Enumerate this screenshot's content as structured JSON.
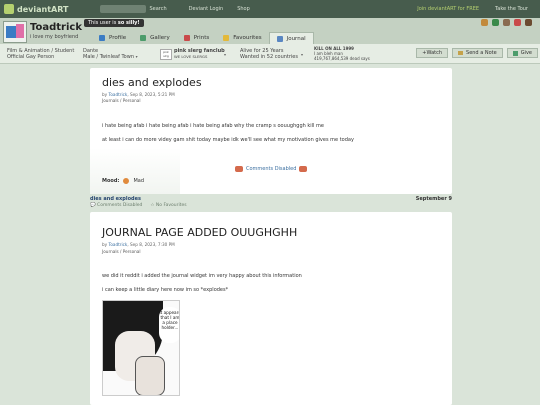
{
  "topbar": {
    "logo": "deviantART",
    "search_label": "Search",
    "nav": [
      "Deviant Login",
      "Shop"
    ],
    "join": "Join deviantART for FREE",
    "tour": "Take the Tour"
  },
  "header": {
    "username": "Toadtrick",
    "tagline": "i love my boyfriend",
    "tooltip_prefix": "This user is ",
    "tooltip_strong": "so silly!",
    "tabs": [
      {
        "label": "Profile",
        "active": false
      },
      {
        "label": "Gallery",
        "active": false
      },
      {
        "label": "Prints",
        "active": false
      },
      {
        "label": "Favourites",
        "active": false
      },
      {
        "label": "Journal",
        "active": true
      }
    ]
  },
  "info": {
    "line1a": "Film & Animation / Student",
    "line1b": "Official Gay Person",
    "name": "Dante",
    "location": "Male / Twinleaf Town",
    "club": "pink slerg fanclub",
    "club_sub": "WE LOVE SLERGS",
    "badge": "pnk slrg",
    "alive": "Alive for 25 Years",
    "wanted": "Wanted in 52 countries",
    "kill_line1": "KILL ON ALL 1999",
    "kill_line2": "I am bleh man",
    "kill_line3": "419,767,864,539 dead says",
    "actions": [
      "+Watch",
      "Send a Note",
      "Give"
    ]
  },
  "entries": [
    {
      "title": "dies and explodes",
      "by": "by ",
      "author": "Toadtrick",
      "date": ", Sep 8, 2023, 5:21 PM",
      "category": "Journals / Personal",
      "body": [
        "i hate being afab i hate being afab i hate being afab why the cramp s oouughggh kill me",
        "at least i can do more videy gam shit today maybe idk we'll see what my motivation gives me today"
      ],
      "comments": "Comments Disabled",
      "mood_label": "Mood:",
      "mood": "Mad"
    },
    {
      "title": "JOURNAL PAGE ADDED OUUGHGHH",
      "by": "by ",
      "author": "Toadtrick",
      "date": ", Sep 8, 2023, 7:30 PM",
      "category": "Journals / Personal",
      "body": [
        "we did it reddit i added the journal widget im very happy about this information",
        "i can keep a little diary here now im so *explodes*"
      ],
      "image_caption": "it appears that I am a place holder..."
    }
  ],
  "footer": {
    "title": "dies and explodes",
    "date": "September 9",
    "comments": "Comments Disabled",
    "favourites": "No Favourites"
  },
  "colors": {
    "topbar": "#475c4d",
    "header": "#c4d1c2",
    "background": "#dae4d9",
    "link": "#3b6fa0"
  }
}
